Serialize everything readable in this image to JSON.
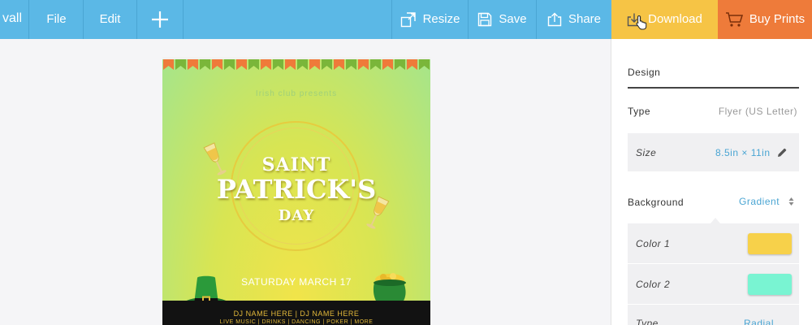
{
  "toolbar": {
    "logo_text": "vall",
    "file_label": "File",
    "edit_label": "Edit",
    "add_label": "+",
    "resize_label": "Resize",
    "save_label": "Save",
    "share_label": "Share",
    "download_label": "Download",
    "buy_prints_label": "Buy Prints"
  },
  "flyer": {
    "tagline": "Irish club presents",
    "title_line1": "SAINT",
    "title_line2": "PATRICK'S",
    "title_line3": "DAY",
    "date": "SATURDAY MARCH 17",
    "djs": "DJ NAME HERE | DJ NAME HERE",
    "events": "LIVE MUSIC | DRINKS | DANCING | POKER | MORE"
  },
  "panel": {
    "design_tab": "Design",
    "type_label": "Type",
    "type_value": "Flyer (US Letter)",
    "size_label": "Size",
    "size_value": "8.5in × 11in",
    "background_label": "Background",
    "background_value": "Gradient",
    "color1_label": "Color 1",
    "color2_label": "Color 2",
    "gradient_type_label": "Type",
    "gradient_type_value": "Radial"
  },
  "colors": {
    "toolbar_bg": "#5bb8e6",
    "download_bg": "#f6c445",
    "buy_prints_bg": "#ee7b3a",
    "color1": "#f7d14a",
    "color2": "#79f4d2",
    "link": "#4aa5d3"
  }
}
